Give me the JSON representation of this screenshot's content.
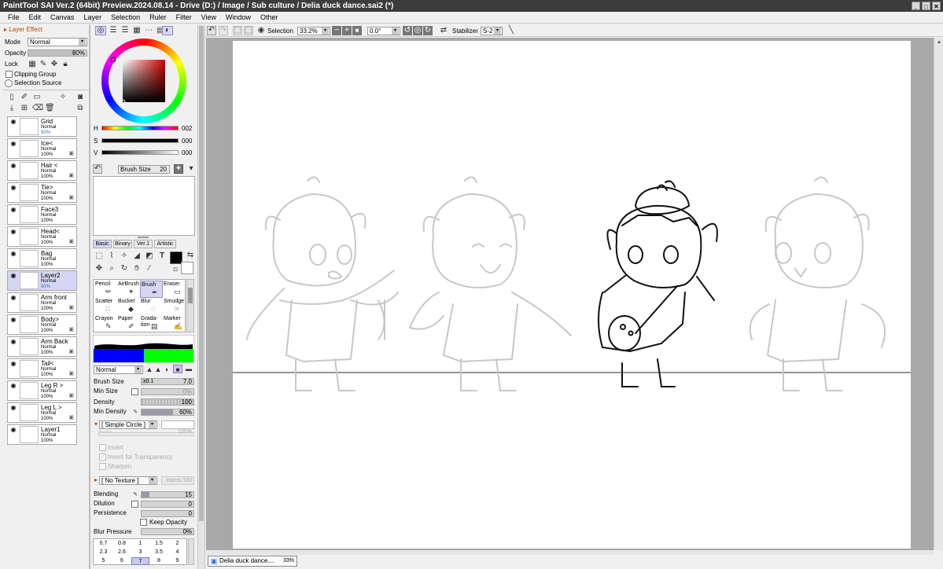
{
  "window": {
    "title": "PaintTool SAI Ver.2 (64bit) Preview.2024.08.14 - Drive (D:) / Image / Sub culture / Delia duck dance.sai2 (*)",
    "min": "_",
    "max": "□",
    "close": "✕"
  },
  "menu": [
    "File",
    "Edit",
    "Canvas",
    "Layer",
    "Selection",
    "Ruler",
    "Filter",
    "View",
    "Window",
    "Other"
  ],
  "layer_effect": {
    "header": "Layer Effect",
    "mode_label": "Mode",
    "mode_value": "Normal",
    "opacity_label": "Opacity",
    "opacity_value": "80%",
    "opacity_pct": 80,
    "lock_label": "Lock",
    "clipping_group": "Clipping Group",
    "selection_source": "Selection Source"
  },
  "layers": [
    {
      "name": "Grid",
      "mode": "Normal",
      "opacity": "50%",
      "active": false,
      "blue": true,
      "lock": false
    },
    {
      "name": "Ice<",
      "mode": "Normal",
      "opacity": "100%",
      "active": false,
      "blue": false,
      "lock": true
    },
    {
      "name": "Hair <",
      "mode": "Normal",
      "opacity": "100%",
      "active": false,
      "blue": false,
      "lock": true
    },
    {
      "name": "Tie>",
      "mode": "Normal",
      "opacity": "100%",
      "active": false,
      "blue": false,
      "lock": true
    },
    {
      "name": "Face3",
      "mode": "Normal",
      "opacity": "100%",
      "active": false,
      "blue": false,
      "lock": false
    },
    {
      "name": "Head<",
      "mode": "Normal",
      "opacity": "100%",
      "active": false,
      "blue": false,
      "lock": true
    },
    {
      "name": "Bag",
      "mode": "Normal",
      "opacity": "100%",
      "active": false,
      "blue": false,
      "lock": false
    },
    {
      "name": "Layer2",
      "mode": "Normal",
      "opacity": "80%",
      "active": true,
      "blue": true,
      "lock": false
    },
    {
      "name": "Arm front",
      "mode": "Normal",
      "opacity": "100%",
      "active": false,
      "blue": false,
      "lock": true
    },
    {
      "name": "Body>",
      "mode": "Normal",
      "opacity": "100%",
      "active": false,
      "blue": false,
      "lock": true
    },
    {
      "name": "Arm Back",
      "mode": "Normal",
      "opacity": "100%",
      "active": false,
      "blue": false,
      "lock": true
    },
    {
      "name": "Tail<",
      "mode": "Normal",
      "opacity": "100%",
      "active": false,
      "blue": false,
      "lock": true
    },
    {
      "name": "Leg R >",
      "mode": "Normal",
      "opacity": "100%",
      "active": false,
      "blue": false,
      "lock": true
    },
    {
      "name": "Leg L >",
      "mode": "Normal",
      "opacity": "100%",
      "active": false,
      "blue": false,
      "lock": true
    },
    {
      "name": "Layer1",
      "mode": "Normal",
      "opacity": "100%",
      "active": false,
      "blue": false,
      "lock": false
    }
  ],
  "color": {
    "h_label": "H",
    "h_value": "002",
    "s_label": "S",
    "s_value": "000",
    "v_label": "V",
    "v_value": "000",
    "primary": "#000000",
    "secondary": "#ffffff"
  },
  "brush_preset": {
    "label": "Brush Size",
    "value": "20"
  },
  "tool_tabs": [
    "Basic",
    "Binary",
    "Ver.1",
    "Artistic"
  ],
  "tools": [
    {
      "name": "Pencil",
      "glyph": "✏"
    },
    {
      "name": "AirBrush",
      "glyph": "✴"
    },
    {
      "name": "Brush",
      "glyph": "✒"
    },
    {
      "name": "Eraser",
      "glyph": "▭"
    },
    {
      "name": "Scatter",
      "glyph": "∷"
    },
    {
      "name": "Bucket",
      "glyph": "◆"
    },
    {
      "name": "Blur",
      "glyph": "◌"
    },
    {
      "name": "Smudge",
      "glyph": "☞"
    },
    {
      "name": "Crayon",
      "glyph": "✎"
    },
    {
      "name": "Paper",
      "glyph": "✐"
    },
    {
      "name": "Grada-tion",
      "glyph": "▤"
    },
    {
      "name": "Marker",
      "glyph": "✍"
    }
  ],
  "brush": {
    "blend_mode": "Normal",
    "size_label": "Brush Size",
    "size_mult": "x0.1",
    "size_value": "7.0",
    "min_size_label": "Min Size",
    "min_size_value": "0%",
    "density_label": "Density",
    "density_value": "100",
    "min_density_label": "Min Density",
    "min_density_value": "60%",
    "min_density_pct": 60,
    "shape": "[ Simple Circle ]",
    "scale_label": "Scale",
    "scale_value": "100%",
    "invert": "Invert",
    "invert_transparency": "Invert for Transparency",
    "sharpen": "Sharpen",
    "texture": "[ No Texture ]",
    "texture_intens": "Intens 100",
    "blending_label": "Blending",
    "blending_value": "15",
    "blending_pct": 15,
    "dilution_label": "Dilution",
    "dilution_value": "0",
    "persistence_label": "Persistence",
    "persistence_value": "0",
    "keep_opacity": "Keep Opacity",
    "blur_pressure_label": "Blur Pressure",
    "blur_pressure_value": "0%"
  },
  "size_grid": [
    "0.7",
    "0.8",
    "1",
    "1.5",
    "2",
    "2.3",
    "2.6",
    "3",
    "3.5",
    "4",
    "5",
    "6",
    "7",
    "8",
    "9"
  ],
  "size_grid_active": "7",
  "toolbar": {
    "selection_label": "Selection",
    "zoom": "33.2%",
    "rotation": "0.0°",
    "stabilizer_label": "Stabilizer",
    "stabilizer_value": "S-2"
  },
  "status": {
    "doc_name": "Delia duck dance....",
    "zoom": "33%"
  },
  "colors": {
    "accent": "#d6d6f4",
    "title_bg": "#3c3c3c",
    "canvas_bg": "#a8a8a8"
  }
}
